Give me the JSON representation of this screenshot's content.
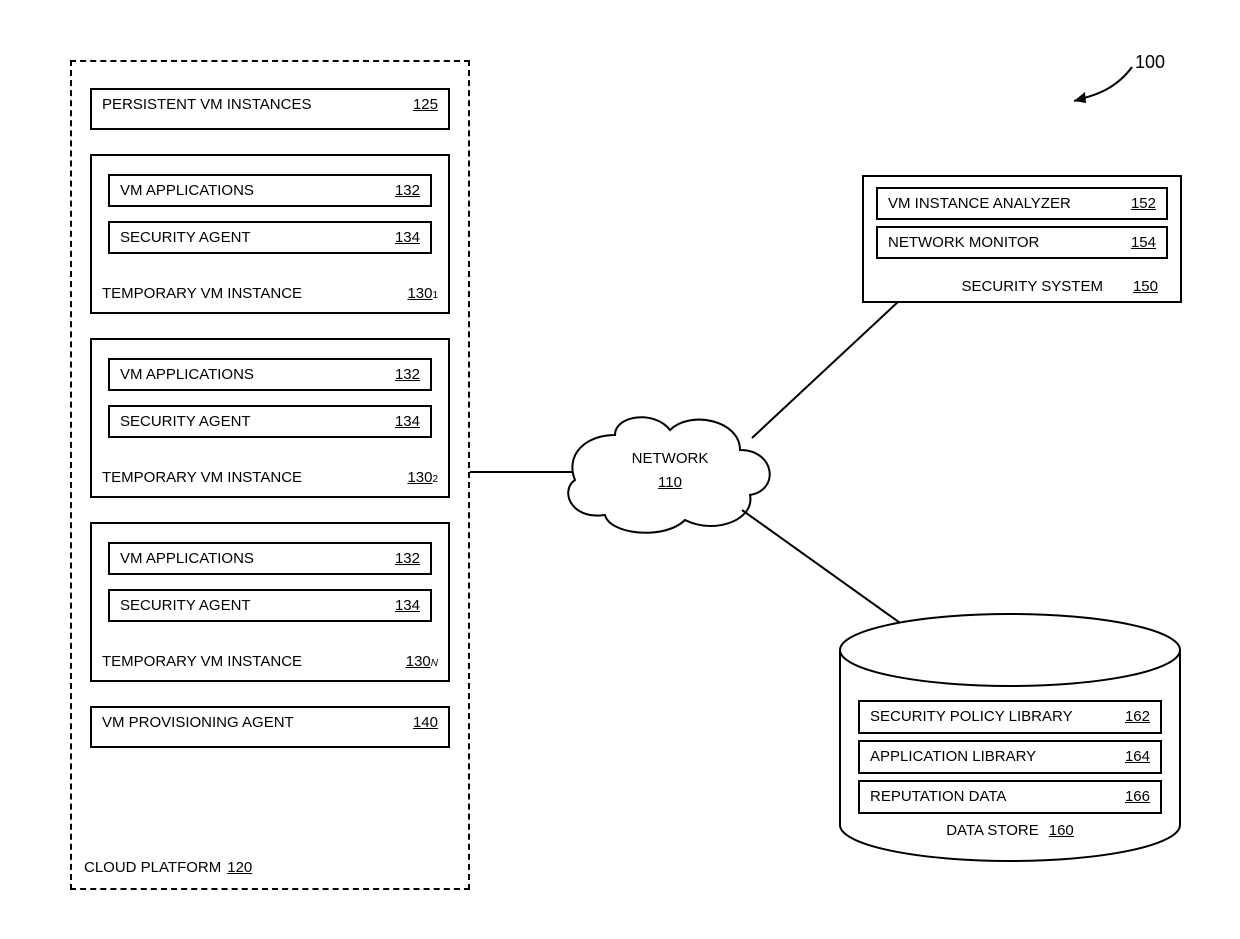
{
  "figure_ref": "100",
  "cloud_platform": {
    "label": "CLOUD PLATFORM",
    "ref": "120",
    "persistent": {
      "label": "PERSISTENT VM INSTANCES",
      "ref": "125"
    },
    "temp_instances": [
      {
        "label": "TEMPORARY VM INSTANCE",
        "ref_base": "130",
        "ref_sub": "1",
        "apps": {
          "label": "VM APPLICATIONS",
          "ref": "132"
        },
        "agent": {
          "label": "SECURITY AGENT",
          "ref": "134"
        }
      },
      {
        "label": "TEMPORARY VM INSTANCE",
        "ref_base": "130",
        "ref_sub": "2",
        "apps": {
          "label": "VM APPLICATIONS",
          "ref": "132"
        },
        "agent": {
          "label": "SECURITY AGENT",
          "ref": "134"
        }
      },
      {
        "label": "TEMPORARY VM INSTANCE",
        "ref_base": "130",
        "ref_sub": "N",
        "apps": {
          "label": "VM APPLICATIONS",
          "ref": "132"
        },
        "agent": {
          "label": "SECURITY AGENT",
          "ref": "134"
        }
      }
    ],
    "provisioning": {
      "label": "VM PROVISIONING AGENT",
      "ref": "140"
    }
  },
  "network": {
    "label": "NETWORK",
    "ref": "110"
  },
  "security_system": {
    "label": "SECURITY SYSTEM",
    "ref": "150",
    "analyzer": {
      "label": "VM INSTANCE ANALYZER",
      "ref": "152"
    },
    "monitor": {
      "label": "NETWORK MONITOR",
      "ref": "154"
    }
  },
  "data_store": {
    "label": "DATA STORE",
    "ref": "160",
    "policy": {
      "label": "SECURITY POLICY LIBRARY",
      "ref": "162"
    },
    "app_lib": {
      "label": "APPLICATION LIBRARY",
      "ref": "164"
    },
    "reputation": {
      "label": "REPUTATION DATA",
      "ref": "166"
    }
  }
}
